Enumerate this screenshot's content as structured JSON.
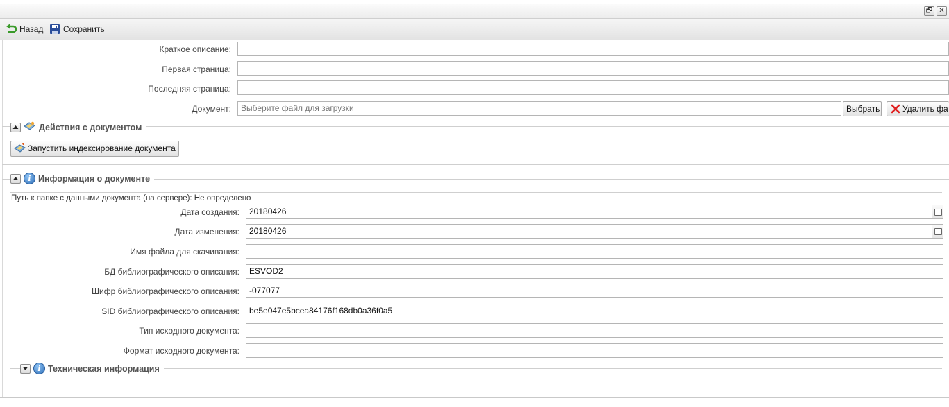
{
  "window": {
    "restore_glyph": "🗗",
    "close_glyph": "✕"
  },
  "toolbar": {
    "back_label": "Назад",
    "save_label": "Сохранить"
  },
  "form": {
    "short_desc_label": "Краткое описание:",
    "short_desc_value": "",
    "first_page_label": "Первая страница:",
    "first_page_value": "",
    "last_page_label": "Последняя страница:",
    "last_page_value": "",
    "document_label": "Документ:",
    "document_placeholder": "Выберите файл для загрузки",
    "choose_button": "Выбрать",
    "delete_button": "Удалить фа"
  },
  "actions_section": {
    "title": "Действия с документом",
    "index_button": "Запустить индексирование документа"
  },
  "info_section": {
    "title": "Информация о документе",
    "path_text": "Путь к папке с данными документа (на сервере): Не определено",
    "fields": [
      {
        "label": "Дата создания:",
        "value": "20180426"
      },
      {
        "label": "Дата изменения:",
        "value": "20180426"
      },
      {
        "label": "Имя файла для скачивания:",
        "value": ""
      },
      {
        "label": "БД библиографического описания:",
        "value": "ESVOD2"
      },
      {
        "label": "Шифр библиографического описания:",
        "value": "-077077"
      },
      {
        "label": "SID библиографического описания:",
        "value": "be5e047e5bcea84176f168db0a36f0a5"
      },
      {
        "label": "Тип исходного документа:",
        "value": ""
      },
      {
        "label": "Формат исходного документа:",
        "value": ""
      }
    ]
  },
  "tech_section": {
    "title": "Техническая информация"
  },
  "colors": {
    "legend_text": "#555555",
    "info_icon": "#2f6fb8",
    "delete_icon": "#e02020",
    "back_icon": "#3a9a2a",
    "save_icon": "#2a4d9a"
  }
}
